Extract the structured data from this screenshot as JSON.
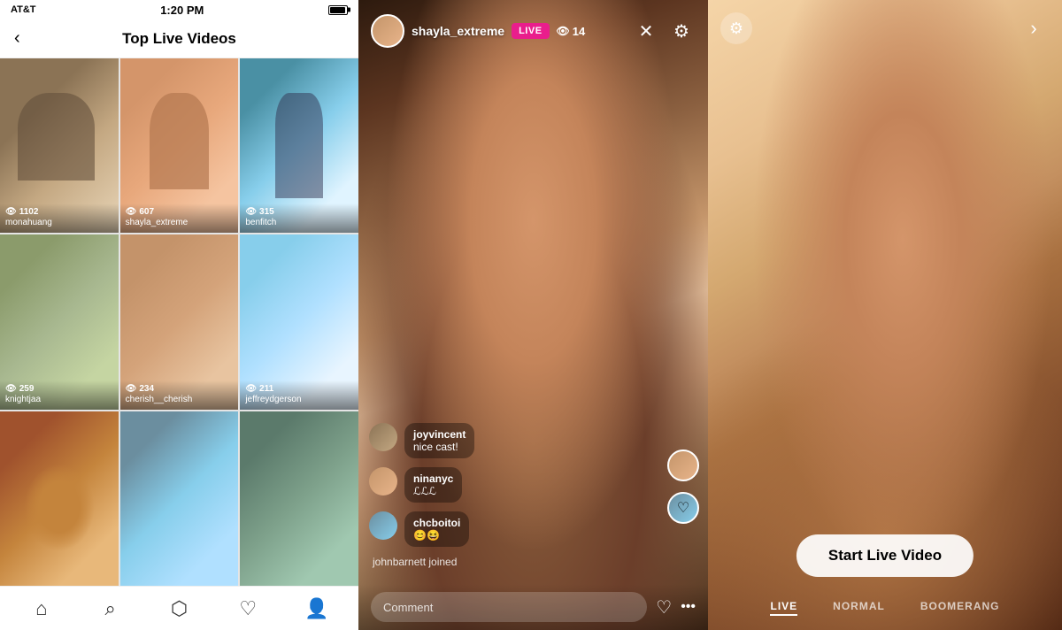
{
  "status_bar": {
    "carrier": "AT&T",
    "time": "1:20 PM",
    "signal": "●●●○○"
  },
  "left_panel": {
    "title": "Top Live Videos",
    "back_label": "‹",
    "grid_items": [
      {
        "id": 1,
        "username": "monahuang",
        "count": "1102",
        "thumb_class": "thumb-1"
      },
      {
        "id": 2,
        "username": "shayla_extreme",
        "count": "607",
        "thumb_class": "thumb-2"
      },
      {
        "id": 3,
        "username": "benfitch",
        "count": "315",
        "thumb_class": "thumb-3"
      },
      {
        "id": 4,
        "username": "knightjaa",
        "count": "259",
        "thumb_class": "thumb-4"
      },
      {
        "id": 5,
        "username": "cherish__cherish",
        "count": "234",
        "thumb_class": "thumb-5"
      },
      {
        "id": 6,
        "username": "jeffreydgerson",
        "count": "211",
        "thumb_class": "thumb-6"
      },
      {
        "id": 7,
        "username": "",
        "count": "",
        "thumb_class": "thumb-7"
      },
      {
        "id": 8,
        "username": "",
        "count": "",
        "thumb_class": "thumb-8"
      },
      {
        "id": 9,
        "username": "",
        "count": "",
        "thumb_class": "thumb-9"
      }
    ],
    "nav_icons": [
      "⌂",
      "⌕",
      "⬡",
      "♡",
      "👤"
    ]
  },
  "middle_panel": {
    "username": "shayla_extreme",
    "live_label": "LIVE",
    "viewer_count": "14",
    "comments": [
      {
        "id": 1,
        "user": "joyvincent",
        "text": "nice cast!",
        "avatar_class": "av-1"
      },
      {
        "id": 2,
        "user": "ninanyc",
        "text": "ℒℒℒ",
        "avatar_class": "av-2"
      },
      {
        "id": 3,
        "user": "chcboitoi",
        "text": "😊😆",
        "avatar_class": "av-3"
      }
    ],
    "join_notice": "johnbarnett joined",
    "comment_placeholder": "Comment",
    "settings_icon": "⚙",
    "close_icon": "✕"
  },
  "right_panel": {
    "start_live_label": "Start Live Video",
    "settings_icon": "⚙",
    "next_arrow": "›",
    "bottom_tabs": [
      {
        "label": "LIVE",
        "active": true
      },
      {
        "label": "NORMAL",
        "active": false
      },
      {
        "label": "BOOMERANG",
        "active": false
      }
    ]
  }
}
